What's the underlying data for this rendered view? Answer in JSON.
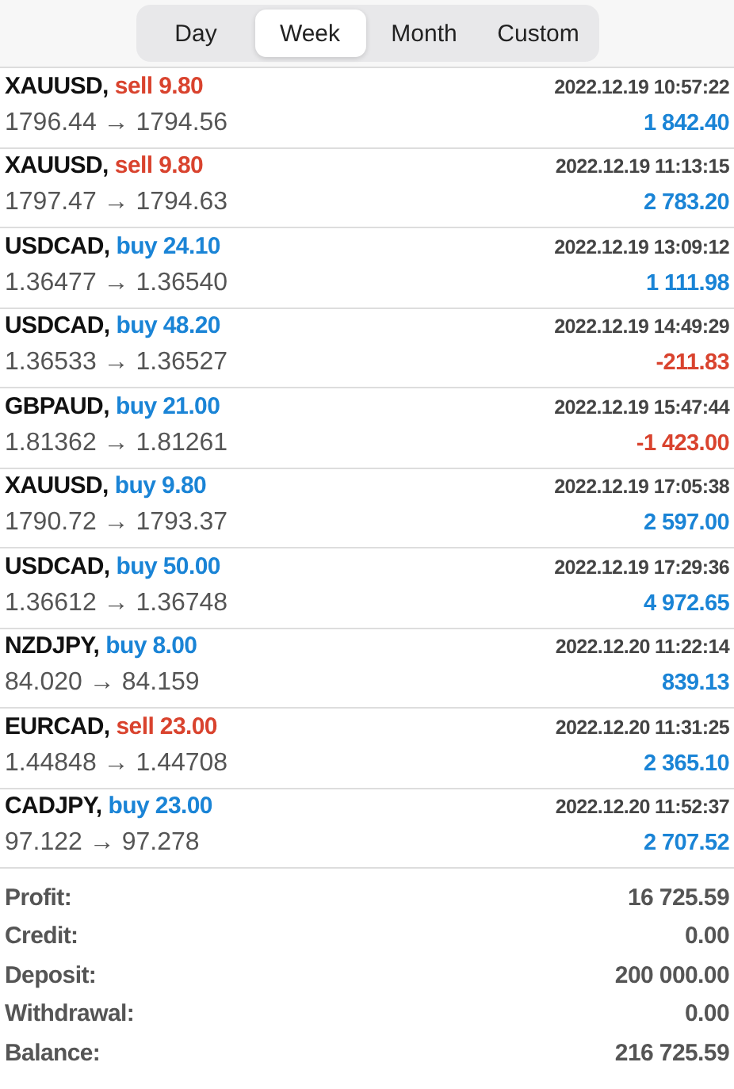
{
  "tabs": [
    {
      "label": "Day",
      "selected": false
    },
    {
      "label": "Week",
      "selected": true
    },
    {
      "label": "Month",
      "selected": false
    },
    {
      "label": "Custom",
      "selected": false
    }
  ],
  "trades": [
    {
      "symbol": "XAUUSD,",
      "side": "sell",
      "volume": "9.80",
      "prices": "1796.44 → 1794.56",
      "time": "2022.12.19 10:57:22",
      "profit": "1 842.40",
      "loss": false
    },
    {
      "symbol": "XAUUSD,",
      "side": "sell",
      "volume": "9.80",
      "prices": "1797.47 → 1794.63",
      "time": "2022.12.19 11:13:15",
      "profit": "2 783.20",
      "loss": false
    },
    {
      "symbol": "USDCAD,",
      "side": "buy",
      "volume": "24.10",
      "prices": "1.36477 → 1.36540",
      "time": "2022.12.19 13:09:12",
      "profit": "1 111.98",
      "loss": false
    },
    {
      "symbol": "USDCAD,",
      "side": "buy",
      "volume": "48.20",
      "prices": "1.36533 → 1.36527",
      "time": "2022.12.19 14:49:29",
      "profit": "-211.83",
      "loss": true
    },
    {
      "symbol": "GBPAUD,",
      "side": "buy",
      "volume": "21.00",
      "prices": "1.81362 → 1.81261",
      "time": "2022.12.19 15:47:44",
      "profit": "-1 423.00",
      "loss": true
    },
    {
      "symbol": "XAUUSD,",
      "side": "buy",
      "volume": "9.80",
      "prices": "1790.72 → 1793.37",
      "time": "2022.12.19 17:05:38",
      "profit": "2 597.00",
      "loss": false
    },
    {
      "symbol": "USDCAD,",
      "side": "buy",
      "volume": "50.00",
      "prices": "1.36612 → 1.36748",
      "time": "2022.12.19 17:29:36",
      "profit": "4 972.65",
      "loss": false
    },
    {
      "symbol": "NZDJPY,",
      "side": "buy",
      "volume": "8.00",
      "prices": "84.020 → 84.159",
      "time": "2022.12.20 11:22:14",
      "profit": "839.13",
      "loss": false
    },
    {
      "symbol": "EURCAD,",
      "side": "sell",
      "volume": "23.00",
      "prices": "1.44848 → 1.44708",
      "time": "2022.12.20 11:31:25",
      "profit": "2 365.10",
      "loss": false
    },
    {
      "symbol": "CADJPY,",
      "side": "buy",
      "volume": "23.00",
      "prices": "97.122 → 97.278",
      "time": "2022.12.20 11:52:37",
      "profit": "2 707.52",
      "loss": false
    }
  ],
  "summary": [
    {
      "label": "Profit:",
      "value": "16 725.59"
    },
    {
      "label": "Credit:",
      "value": "0.00"
    },
    {
      "label": "Deposit:",
      "value": "200 000.00"
    },
    {
      "label": "Withdrawal:",
      "value": "0.00"
    },
    {
      "label": "Balance:",
      "value": "216 725.59"
    }
  ]
}
